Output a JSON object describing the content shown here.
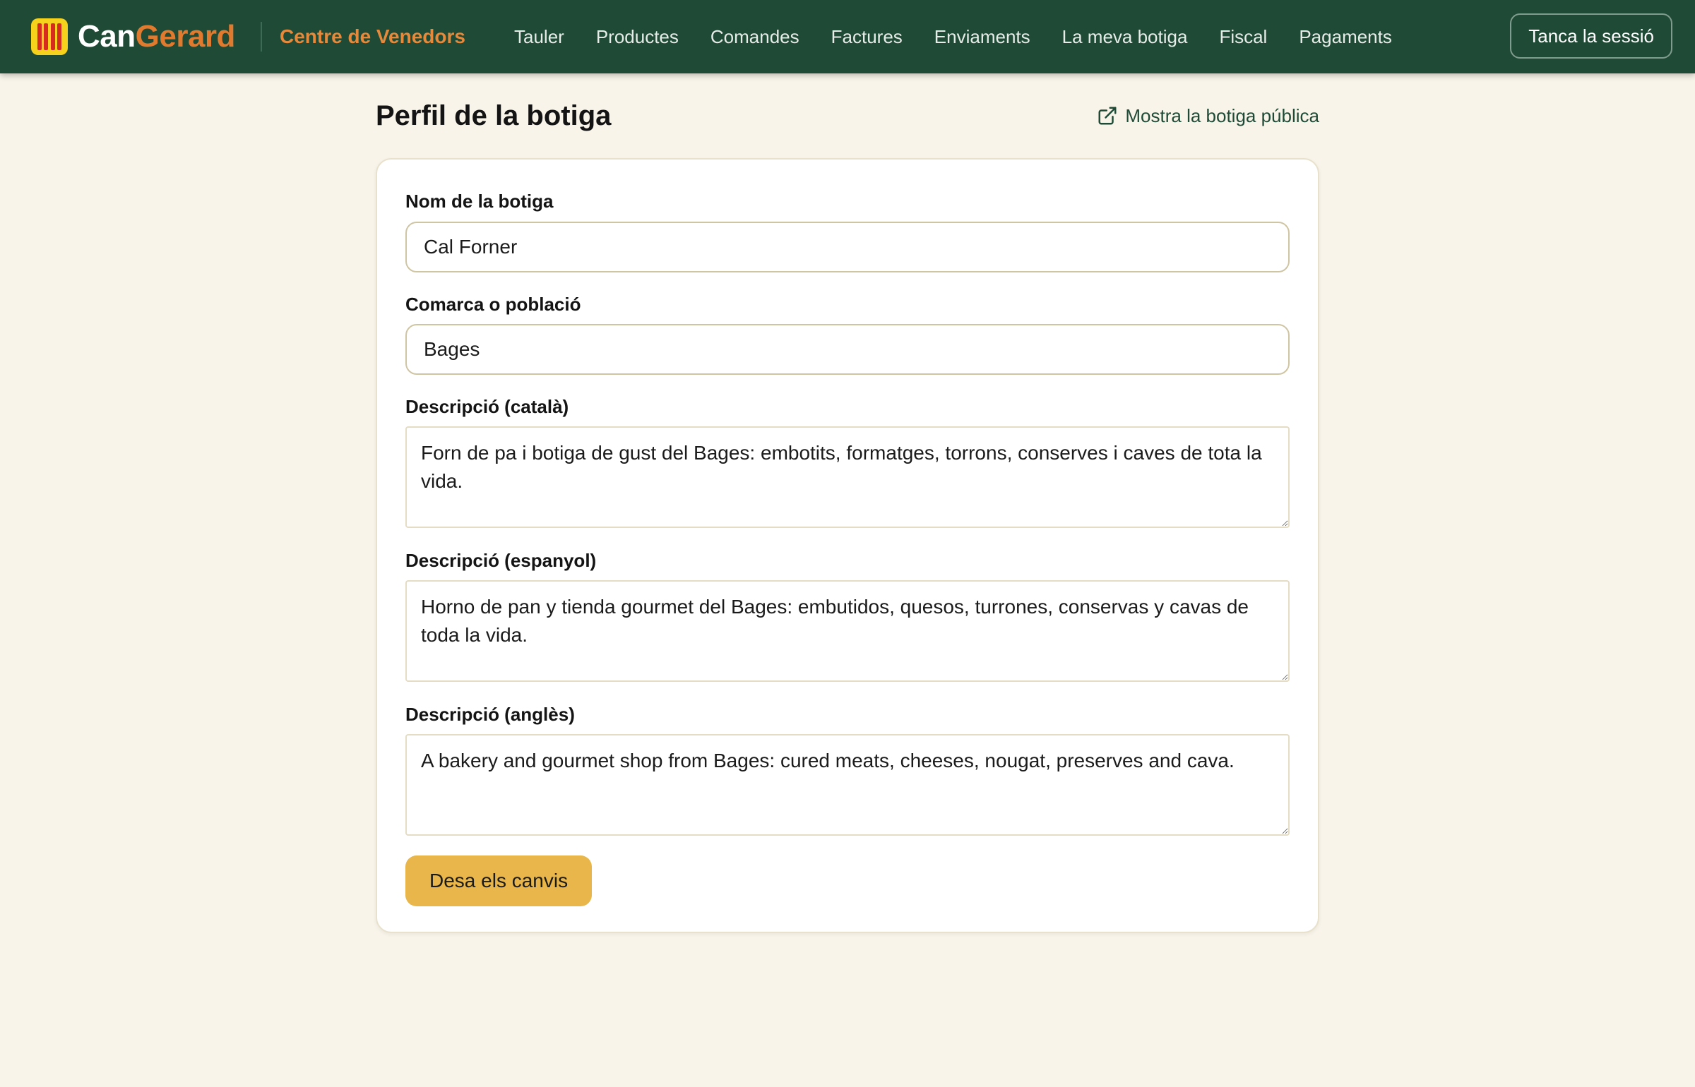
{
  "brand": {
    "name_part1": "Can",
    "name_part2": "Gerard",
    "logo_icon": "catalan-flag-icon"
  },
  "header": {
    "center_title": "Centre de Venedors",
    "nav": [
      {
        "label": "Tauler"
      },
      {
        "label": "Productes"
      },
      {
        "label": "Comandes"
      },
      {
        "label": "Factures"
      },
      {
        "label": "Enviaments"
      },
      {
        "label": "La meva botiga"
      },
      {
        "label": "Fiscal"
      },
      {
        "label": "Pagaments"
      }
    ],
    "logout_label": "Tanca la sessió"
  },
  "page": {
    "title": "Perfil de la botiga",
    "public_link_label": "Mostra la botiga pública",
    "public_link_icon": "external-link-icon"
  },
  "form": {
    "shop_name": {
      "label": "Nom de la botiga",
      "value": "Cal Forner"
    },
    "region": {
      "label": "Comarca o població",
      "value": "Bages"
    },
    "description_ca": {
      "label": "Descripció (català)",
      "value": "Forn de pa i botiga de gust del Bages: embotits, formatges, torrons, conserves i caves de tota la vida."
    },
    "description_es": {
      "label": "Descripció (espanyol)",
      "value": "Horno de pan y tienda gourmet del Bages: embutidos, quesos, turrones, conservas y cavas de toda la vida."
    },
    "description_en": {
      "label": "Descripció (anglès)",
      "value": "A bakery and gourmet shop from Bages: cured meats, cheeses, nougat, preserves and cava."
    },
    "save_label": "Desa els canvis"
  },
  "colors": {
    "topbar": "#1f4a35",
    "brand_accent": "#e07a2e",
    "page_background": "#f8f4ea",
    "save_button": "#e8b64a"
  }
}
